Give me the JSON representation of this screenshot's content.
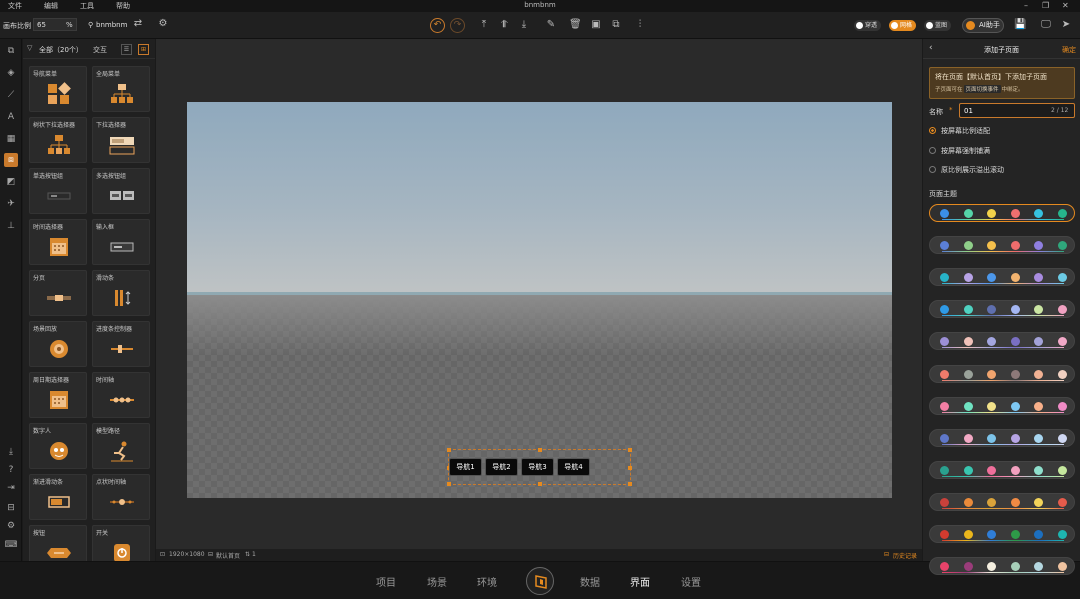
{
  "app": {
    "title": "bnmbnm"
  },
  "menu": [
    "文件",
    "编辑",
    "工具",
    "帮助"
  ],
  "toolbar": {
    "scale_label": "画布比例",
    "scale_value": "65",
    "scale_unit": "%",
    "project_name": "bnmbnm",
    "toggle_through": "穿透",
    "toggle_grid": "网格",
    "toggle_blue": "蓝图",
    "ai_label": "AI助手"
  },
  "left_panel": {
    "filter_label": "全部（20个）",
    "interact_label": "交互",
    "components": [
      {
        "label": "导航菜单",
        "icon": "nav-menu-icon"
      },
      {
        "label": "全局菜单",
        "icon": "global-menu-icon"
      },
      {
        "label": "树状下拉选择器",
        "icon": "tree-select-icon"
      },
      {
        "label": "下拉选择器",
        "icon": "dropdown-select-icon"
      },
      {
        "label": "单选按钮组",
        "icon": "radio-group-icon"
      },
      {
        "label": "多选按钮组",
        "icon": "checkbox-group-icon"
      },
      {
        "label": "时间选择器",
        "icon": "time-picker-icon"
      },
      {
        "label": "输入框",
        "icon": "input-box-icon"
      },
      {
        "label": "分页",
        "icon": "pagination-icon"
      },
      {
        "label": "滑动条",
        "icon": "scrollbar-icon"
      },
      {
        "label": "场景回放",
        "icon": "scene-replay-icon"
      },
      {
        "label": "进度条控制器",
        "icon": "progress-control-icon"
      },
      {
        "label": "周日期选择器",
        "icon": "week-date-picker-icon"
      },
      {
        "label": "时间轴",
        "icon": "timeline-icon"
      },
      {
        "label": "数字人",
        "icon": "digital-human-icon"
      },
      {
        "label": "模型路径",
        "icon": "model-path-icon"
      },
      {
        "label": "渐进滑动条",
        "icon": "gradual-slider-icon"
      },
      {
        "label": "点状时间轴",
        "icon": "dot-timeline-icon"
      },
      {
        "label": "按钮",
        "icon": "button-icon"
      },
      {
        "label": "开关",
        "icon": "switch-icon"
      }
    ]
  },
  "canvas": {
    "nav_items": [
      "导航1",
      "导航2",
      "导航3",
      "导航4"
    ]
  },
  "statusbar": {
    "resolution": "1920×1080",
    "page": "默认首页",
    "count": "1",
    "history": "历史记录"
  },
  "bottom_tabs": [
    "项目",
    "场景",
    "环境",
    "数据",
    "界面",
    "设置"
  ],
  "bottom_active": "界面",
  "right_panel": {
    "title": "添加子页面",
    "confirm": "确定",
    "notice_main": "将在页面【默认首页】下添加子页面",
    "notice_sub_a": "子页面可在",
    "notice_sub_chip": "页面切换事件",
    "notice_sub_b": "中绑定。",
    "name_label": "名称",
    "name_required": "*",
    "name_value": "01",
    "name_count": "2 / 12",
    "scale_options": [
      "按屏幕比例适配",
      "按屏幕强制铺满",
      "原比例展示溢出滚动"
    ],
    "scale_selected": 0,
    "theme_label": "页面主题",
    "themes": [
      [
        "#3b8fe8",
        "#55d5a8",
        "#f2d34a",
        "#ef6f6f",
        "#36c2e0",
        "#26b58c"
      ],
      [
        "#5b7fd6",
        "#8fcf8a",
        "#f5c04c",
        "#ee6c6c",
        "#8f7fe0",
        "#2fa77c"
      ],
      [
        "#27b3c8",
        "#b8a3e6",
        "#4c97ea",
        "#f2b36f",
        "#a98ce0",
        "#6ccbe5"
      ],
      [
        "#2f9ae6",
        "#4fd1c0",
        "#5f6fae",
        "#a4b6f2",
        "#cbe6a3",
        "#f0a1c1"
      ],
      [
        "#9c8fd6",
        "#f0c2b9",
        "#a3a6e0",
        "#7a6fc2",
        "#a3a2d8",
        "#f2a9c8"
      ],
      [
        "#ee7b6b",
        "#9aa29a",
        "#f1a46e",
        "#8d7979",
        "#f0b193",
        "#f1d1c2"
      ],
      [
        "#f27fa4",
        "#6fe3c2",
        "#f2e28a",
        "#7ec8f3",
        "#f8b08a",
        "#f08bc6"
      ],
      [
        "#5f77c8",
        "#f2a9c4",
        "#7cc3e9",
        "#b6a4e4",
        "#a8d6f0",
        "#cfd7f2"
      ],
      [
        "#2aa18f",
        "#39c6b0",
        "#ef6f9b",
        "#f2a0bf",
        "#8fe0cd",
        "#c6e89e"
      ],
      [
        "#c9413b",
        "#ea8a3a",
        "#d9a33a",
        "#f08a44",
        "#f2d45a",
        "#e65b4b"
      ],
      [
        "#d33b2f",
        "#eab61c",
        "#2f7ed8",
        "#2e9a48",
        "#1c6fbf",
        "#1db5b0"
      ],
      [
        "#e8436a",
        "#9a3c7a",
        "#f4efe0",
        "#a7cfb9",
        "#b5d8e0",
        "#efc3a0"
      ]
    ],
    "theme_selected": 0
  },
  "colors": {
    "accent": "#e58a1f"
  }
}
